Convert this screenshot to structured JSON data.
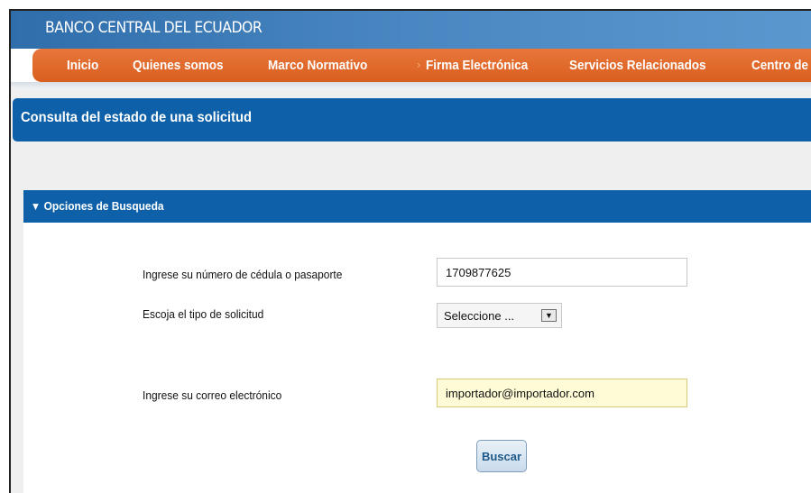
{
  "header": {
    "brand": "BANCO CENTRAL DEL ECUADOR"
  },
  "nav": {
    "items": [
      {
        "label": "Inicio"
      },
      {
        "label": "Quienes somos"
      },
      {
        "label": "Marco Normativo"
      },
      {
        "label": "Firma Electrónica",
        "active": true
      },
      {
        "label": "Servicios Relacionados"
      },
      {
        "label": "Centro de D"
      }
    ],
    "active_marker": "›"
  },
  "page": {
    "title": "Consulta del estado de una solicitud"
  },
  "search_panel": {
    "title": "Opciones de Busqueda",
    "toggle_glyph": "▼",
    "id_label": "Ingrese su número de cédula o pasaporte",
    "id_value": "1709877625",
    "type_label": "Escoja el tipo de solicitud",
    "type_selected": "Seleccione ...",
    "dropdown_glyph": "▼",
    "email_label": "Ingrese su correo electrónico",
    "email_value": "importador@importador.com",
    "search_button": "Buscar"
  },
  "colors": {
    "nav_orange": "#d95f1f",
    "title_blue": "#0e61a8",
    "focus_yellow": "#fffbd6"
  }
}
